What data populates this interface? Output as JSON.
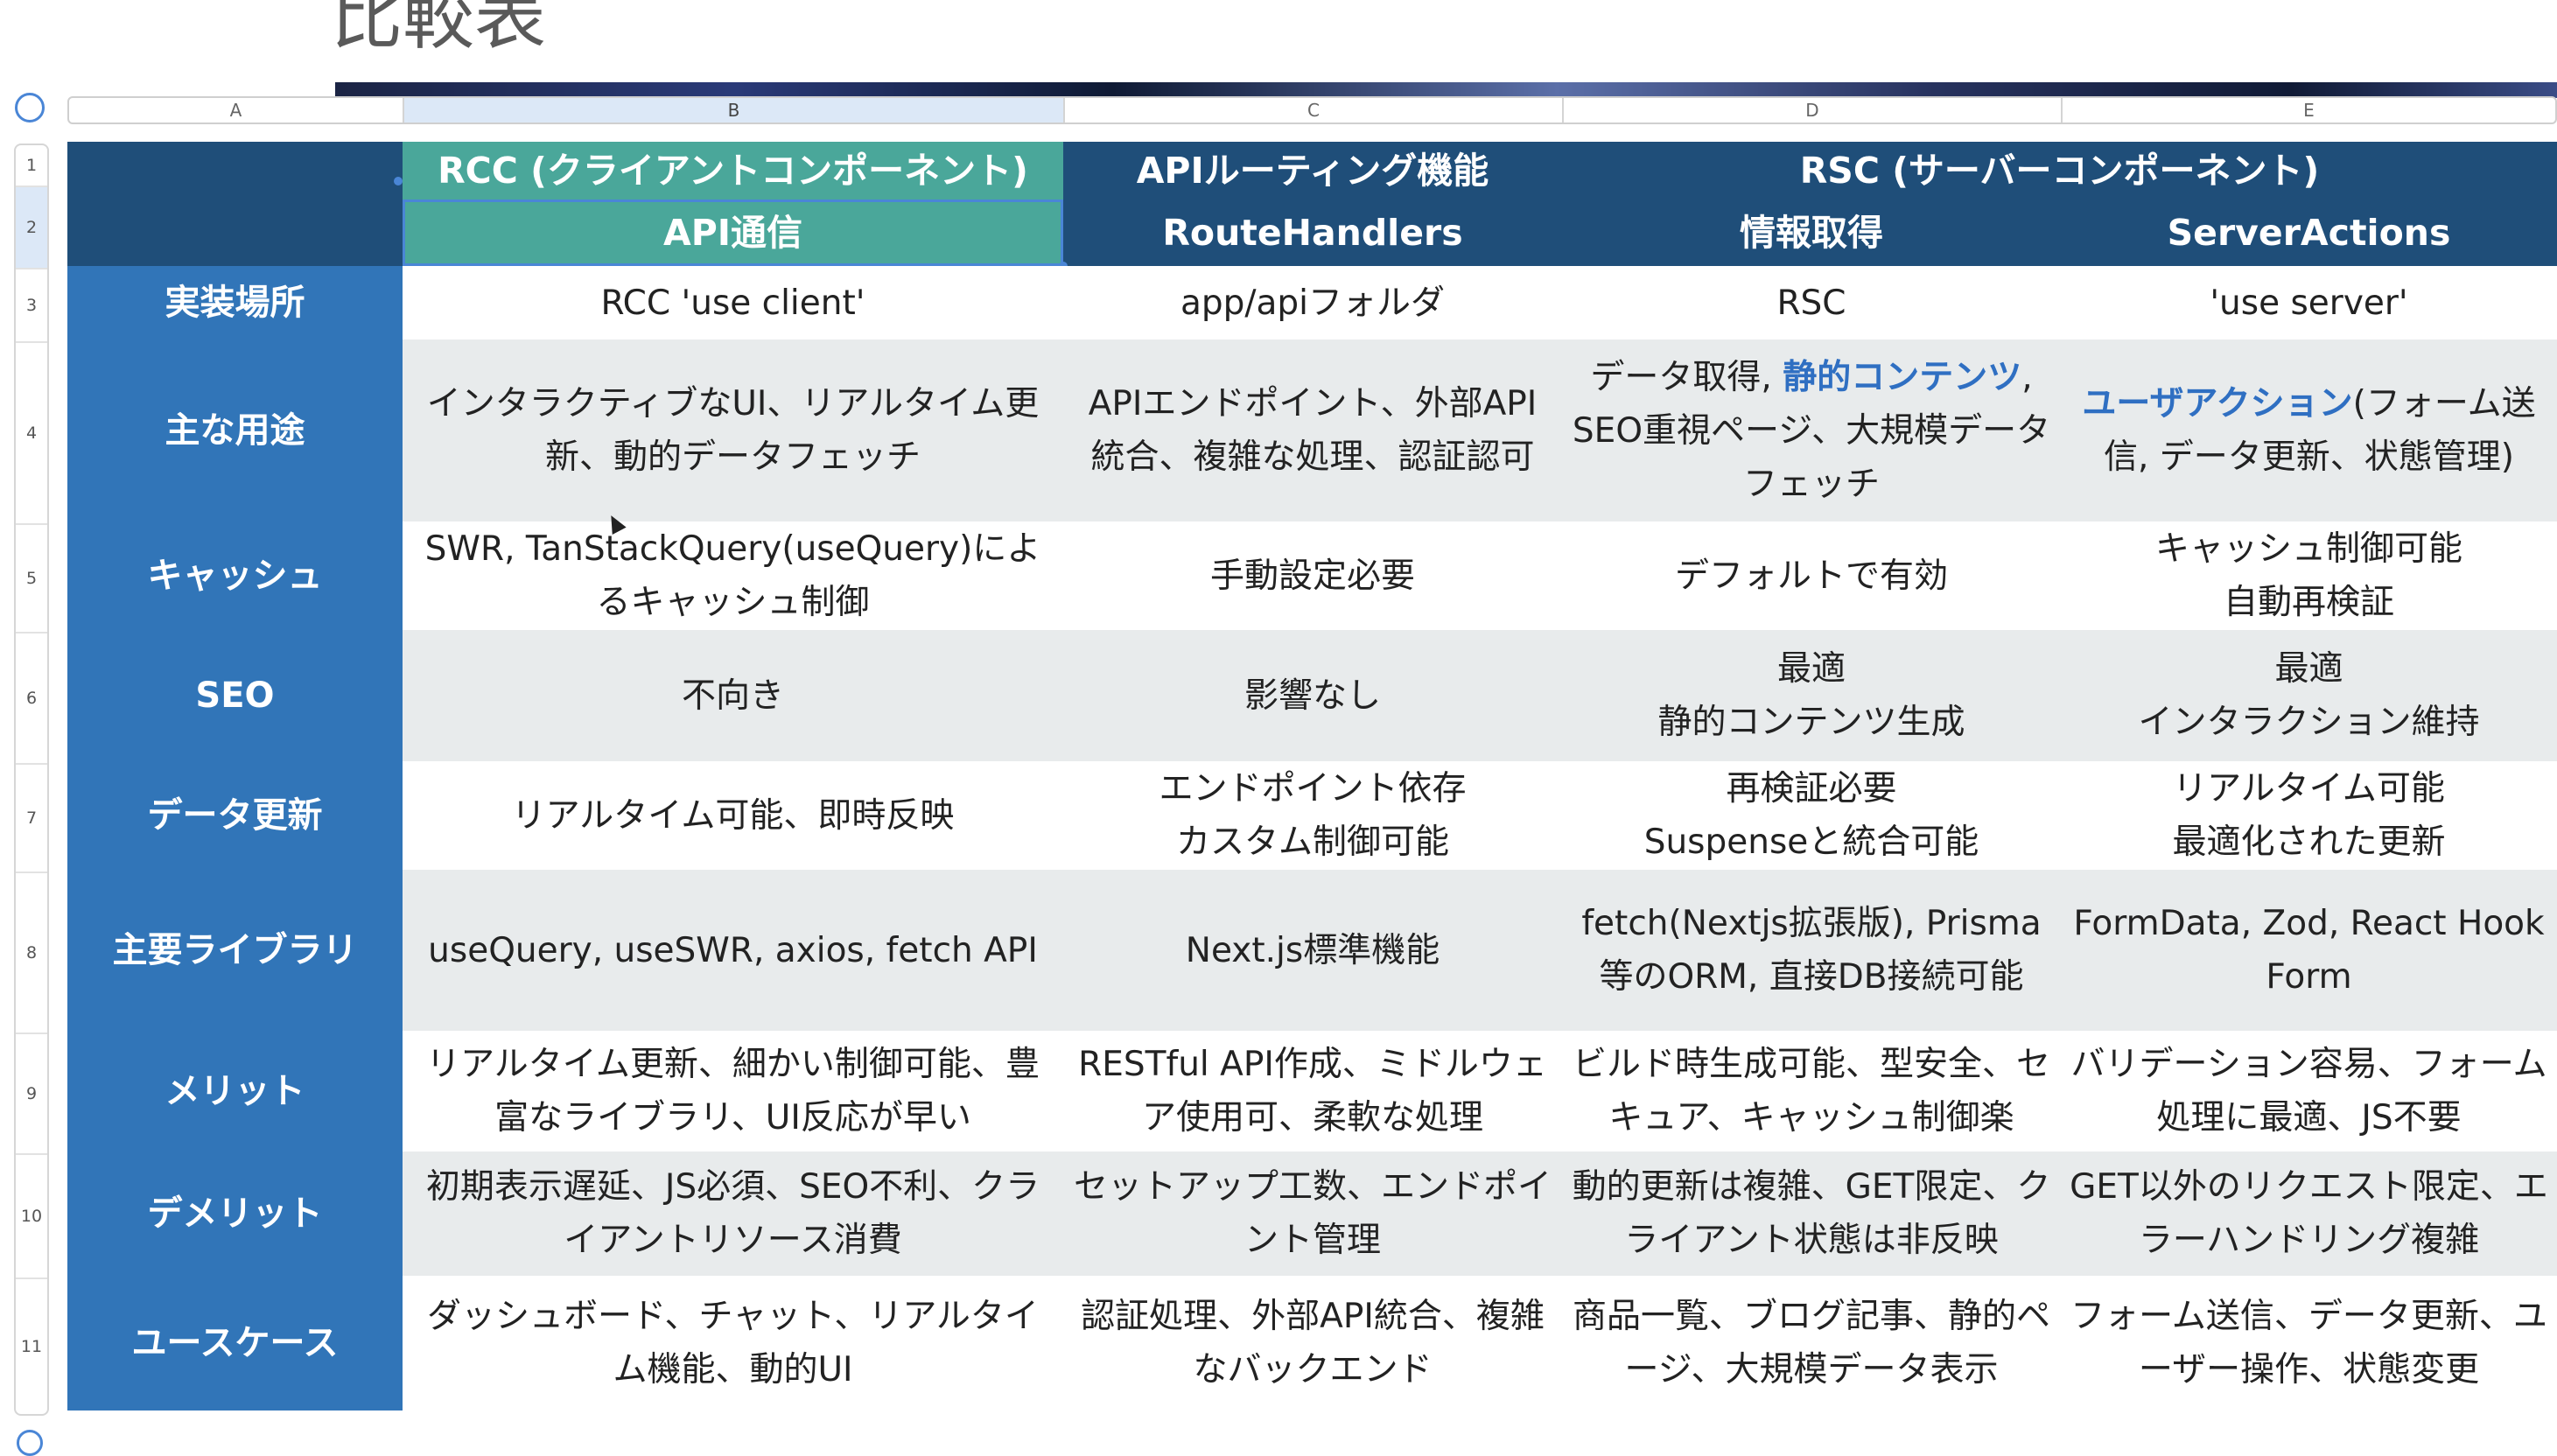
{
  "page": {
    "title": "比較表"
  },
  "colors": {
    "header_dark": "#1f4e79",
    "header_selected": "#4aa79a",
    "row_label_bg": "#3175b8",
    "row_even_bg": "#e8ebec",
    "row_odd_bg": "#ffffff",
    "selection": "#4a86d6",
    "highlight_text": "#2f6fc2"
  },
  "columns": [
    "A",
    "B",
    "C",
    "D",
    "E"
  ],
  "rows": [
    "1",
    "2",
    "3",
    "4",
    "5",
    "6",
    "7",
    "8",
    "9",
    "10",
    "11"
  ],
  "header": {
    "group_rcc": "RCC (クライアントコンポーネント)",
    "group_api": "APIルーティング機能",
    "group_rsc": "RSC (サーバーコンポーネント)",
    "sub_rcc": "API通信",
    "sub_api": "RouteHandlers",
    "sub_rsc_fetch": "情報取得",
    "sub_rsc_actions": "ServerActions"
  },
  "table": {
    "rows": [
      {
        "label": "実装場所",
        "b": "RCC 'use client'",
        "c": "app/apiフォルダ",
        "d": "RSC",
        "e": "'use server'"
      },
      {
        "label": "主な用途",
        "b": "インタラクティブなUI、リアルタイム更新、動的データフェッチ",
        "c": "APIエンドポイント、外部API統合、複雑な処理、認証認可",
        "d_parts": [
          "データ取得, ",
          "静的コンテンツ",
          ", SEO重視ページ、大規模データフェッチ"
        ],
        "e_parts": [
          "ユーザアクション",
          "(フォーム送信, データ更新、状態管理)"
        ]
      },
      {
        "label": "キャッシュ",
        "b": "SWR, TanStackQuery(useQuery)によるキャッシュ制御",
        "c": "手動設定必要",
        "d": "デフォルトで有効",
        "e": "キャッシュ制御可能\n自動再検証"
      },
      {
        "label": "SEO",
        "b": "不向き",
        "c": "影響なし",
        "d": "最適\n静的コンテンツ生成",
        "e": "最適\nインタラクション維持"
      },
      {
        "label": "データ更新",
        "b": "リアルタイム可能、即時反映",
        "c": "エンドポイント依存\nカスタム制御可能",
        "d": "再検証必要\nSuspenseと統合可能",
        "e": "リアルタイム可能\n最適化された更新"
      },
      {
        "label": "主要ライブラリ",
        "b": "useQuery, useSWR, axios, fetch API",
        "c": "Next.js標準機能",
        "d": "fetch(Nextjs拡張版), Prisma等のORM, 直接DB接続可能",
        "e": "FormData, Zod, React Hook Form"
      },
      {
        "label": "メリット",
        "b": "リアルタイム更新、細かい制御可能、豊富なライブラリ、UI反応が早い",
        "c": "RESTful API作成、ミドルウェア使用可、柔軟な処理",
        "d": "ビルド時生成可能、型安全、セキュア、キャッシュ制御楽",
        "e": "バリデーション容易、フォーム処理に最適、JS不要"
      },
      {
        "label": "デメリット",
        "b": "初期表示遅延、JS必須、SEO不利、クライアントリソース消費",
        "c": "セットアップ工数、エンドポイント管理",
        "d": "動的更新は複雑、GET限定、クライアント状態は非反映",
        "e": "GET以外のリクエスト限定、エラーハンドリング複雑"
      },
      {
        "label": "ユースケース",
        "b": "ダッシュボード、チャット、リアルタイム機能、動的UI",
        "c": "認証処理、外部API統合、複雑なバックエンド",
        "d": "商品一覧、ブログ記事、静的ページ、大規模データ表示",
        "e": "フォーム送信、データ更新、ユーザー操作、状態変更"
      }
    ]
  }
}
